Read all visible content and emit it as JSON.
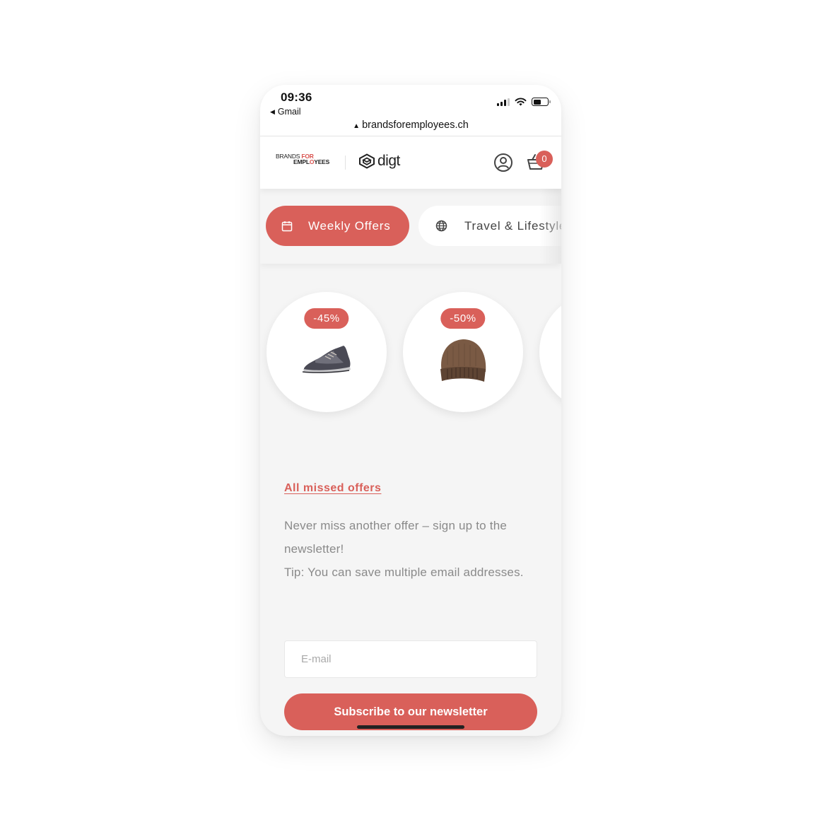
{
  "status_bar": {
    "time": "09:36",
    "back_app": "Gmail",
    "url": "brandsforemployees.ch"
  },
  "header": {
    "logo_brand": {
      "line1_a": "BRANDS ",
      "line1_b": "FOR",
      "line2_a": "EMPL",
      "line2_b": "O",
      "line2_c": "YEES"
    },
    "logo_partner": "digt",
    "cart_count": "0",
    "icons": {
      "account": "user-circle-icon",
      "cart": "basket-icon"
    }
  },
  "categories": [
    {
      "label": "Weekly Offers",
      "icon": "calendar-icon",
      "active": true
    },
    {
      "label": "Travel & Lifestyle",
      "icon": "globe-icon",
      "active": false
    }
  ],
  "products": [
    {
      "discount": "-45%",
      "image": "running-shoe"
    },
    {
      "discount": "-50%",
      "image": "knit-beanie"
    }
  ],
  "content": {
    "missed_link": "All missed offers",
    "newsletter_line1": "Never miss another offer – sign up to the newsletter!",
    "newsletter_line2": "Tip: You can save multiple email addresses.",
    "email_placeholder": "E-mail",
    "email_value": "",
    "subscribe_label": "Subscribe to our newsletter"
  },
  "colors": {
    "accent": "#d9605a",
    "background": "#f5f5f5",
    "text_muted": "#8a8a8a"
  }
}
